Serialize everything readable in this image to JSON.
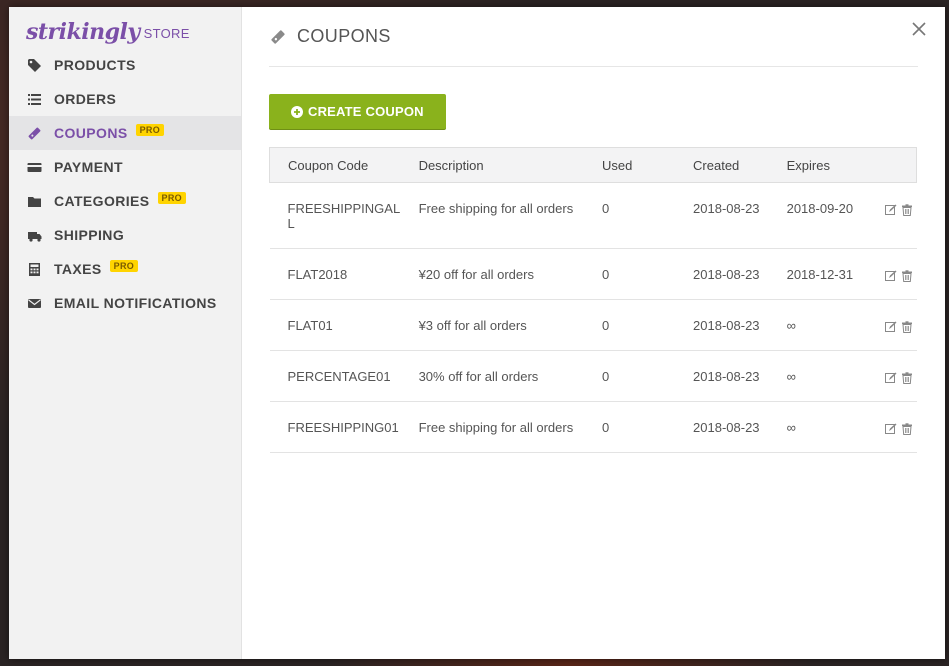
{
  "brand": {
    "logo_text": "strikingly",
    "suffix": "STORE"
  },
  "sidebar": {
    "items": [
      {
        "label": "PRODUCTS",
        "icon": "tag-icon",
        "pro": ""
      },
      {
        "label": "ORDERS",
        "icon": "list-icon",
        "pro": ""
      },
      {
        "label": "COUPONS",
        "icon": "ticket-icon",
        "pro": "PRO",
        "active": true
      },
      {
        "label": "PAYMENT",
        "icon": "credit-card-icon",
        "pro": ""
      },
      {
        "label": "CATEGORIES",
        "icon": "folder-icon",
        "pro": "PRO"
      },
      {
        "label": "SHIPPING",
        "icon": "truck-icon",
        "pro": ""
      },
      {
        "label": "TAXES",
        "icon": "calculator-icon",
        "pro": "PRO"
      },
      {
        "label": "EMAIL NOTIFICATIONS",
        "icon": "envelope-icon",
        "pro": ""
      }
    ]
  },
  "main": {
    "title": "COUPONS",
    "create_button": "CREATE COUPON",
    "columns": [
      "Coupon Code",
      "Description",
      "Used",
      "Created",
      "Expires"
    ],
    "rows": [
      {
        "code": "FREESHIPPINGALL",
        "description": "Free shipping for all orders",
        "used": "0",
        "created": "2018-08-23",
        "expires": "2018-09-20"
      },
      {
        "code": "FLAT2018",
        "description": "¥20 off for all orders",
        "used": "0",
        "created": "2018-08-23",
        "expires": "2018-12-31"
      },
      {
        "code": "FLAT01",
        "description": "¥3 off for all orders",
        "used": "0",
        "created": "2018-08-23",
        "expires": "∞"
      },
      {
        "code": "PERCENTAGE01",
        "description": "30% off for all orders",
        "used": "0",
        "created": "2018-08-23",
        "expires": "∞"
      },
      {
        "code": "FREESHIPPING01",
        "description": "Free shipping for all orders",
        "used": "0",
        "created": "2018-08-23",
        "expires": "∞"
      }
    ]
  },
  "colors": {
    "brand": "#7b4fa8",
    "accent_green": "#8ab21c",
    "pro_badge": "#ffd400"
  }
}
